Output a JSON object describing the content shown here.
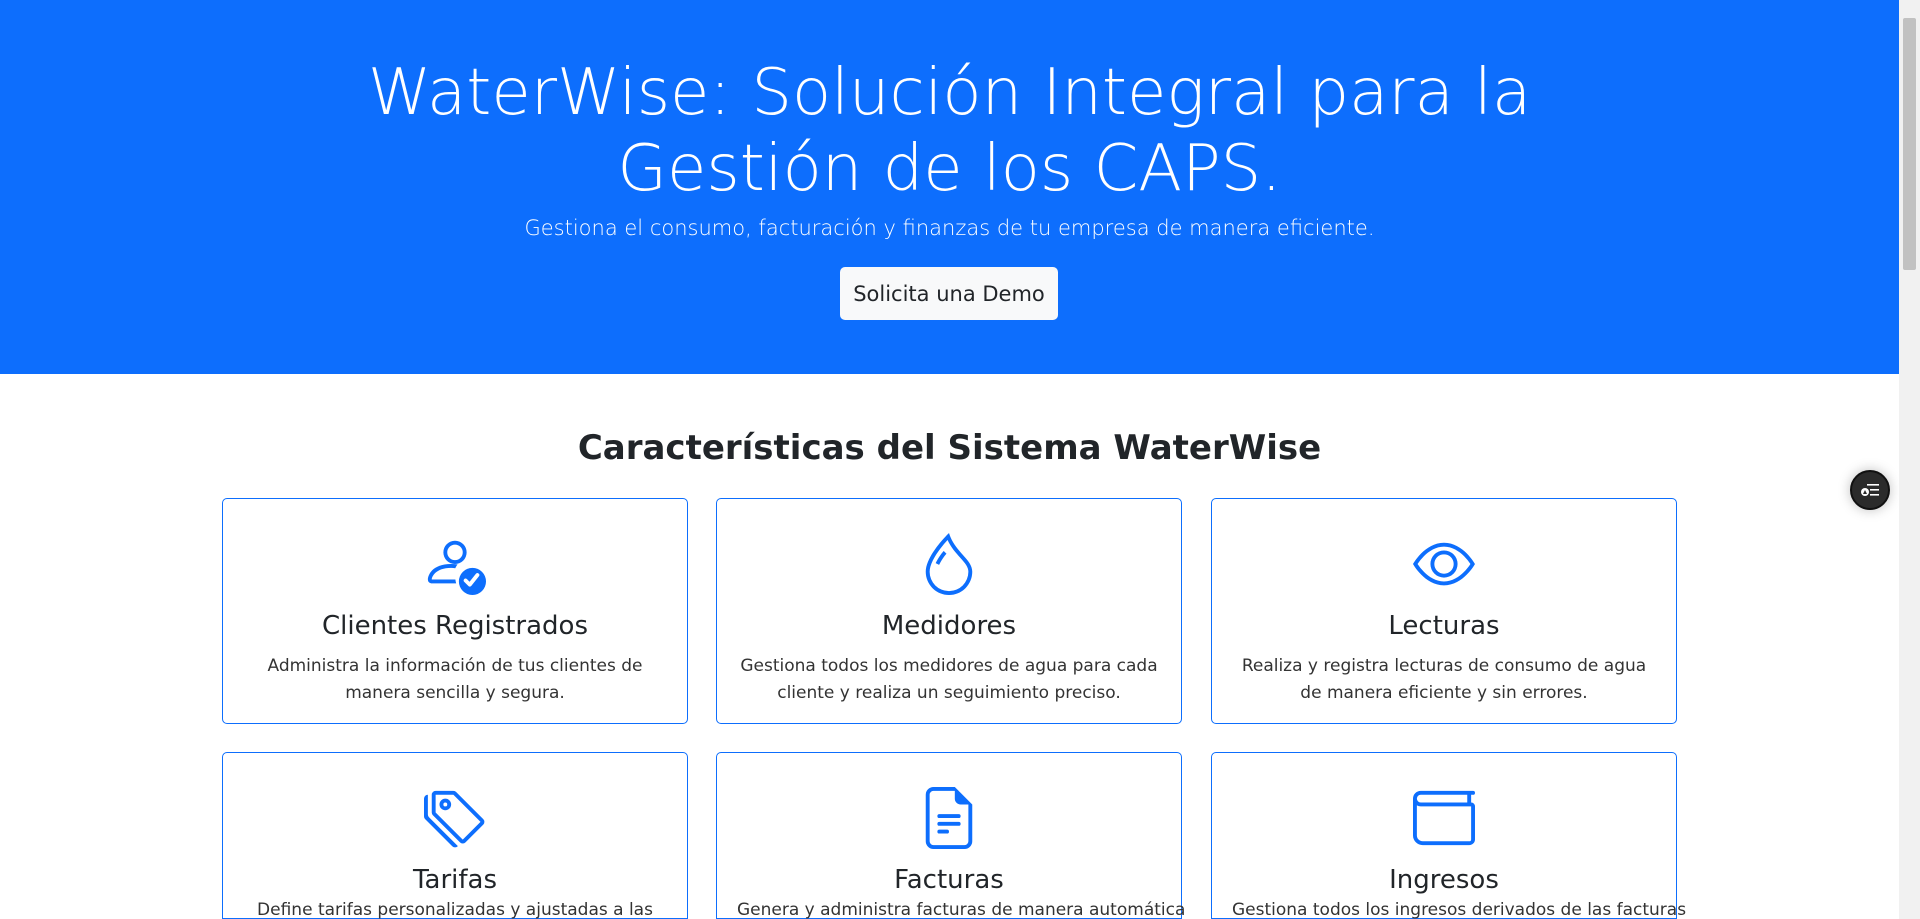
{
  "hero": {
    "title": "WaterWise: Solución Integral para la Gestión de los CAPS.",
    "subtitle": "Gestiona el consumo, facturación y finanzas de tu empresa de manera eficiente.",
    "cta_label": "Solicita una Demo",
    "background_color": "#0d6efd"
  },
  "features": {
    "title": "Características del Sistema WaterWise",
    "cards": [
      {
        "icon": "person-check-icon",
        "title": "Clientes Registrados",
        "description": "Administra la información de tus clientes de manera sencilla y segura."
      },
      {
        "icon": "droplet-icon",
        "title": "Medidores",
        "description": "Gestiona todos los medidores de agua para cada cliente y realiza un seguimiento preciso."
      },
      {
        "icon": "eye-icon",
        "title": "Lecturas",
        "description": "Realiza y registra lecturas de consumo de agua de manera eficiente y sin errores."
      },
      {
        "icon": "tags-icon",
        "title": "Tarifas",
        "description": "Define tarifas personalizadas y ajustadas a las"
      },
      {
        "icon": "file-text-icon",
        "title": "Facturas",
        "description": "Genera y administra facturas de manera automática"
      },
      {
        "icon": "wallet-icon",
        "title": "Ingresos",
        "description": "Gestiona todos los ingresos derivados de las facturas"
      }
    ]
  },
  "accent_color": "#0d6efd"
}
